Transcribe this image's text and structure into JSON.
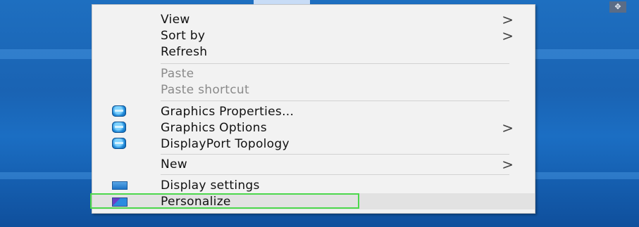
{
  "menu": {
    "items": [
      {
        "label": "View",
        "submenu": true
      },
      {
        "label": "Sort by",
        "submenu": true
      },
      {
        "label": "Refresh"
      },
      {
        "label": "Paste",
        "disabled": true
      },
      {
        "label": "Paste shortcut",
        "disabled": true
      },
      {
        "label": "Graphics Properties...",
        "icon": "intel-graphics-icon"
      },
      {
        "label": "Graphics Options",
        "icon": "intel-graphics-icon",
        "submenu": true
      },
      {
        "label": "DisplayPort Topology",
        "icon": "intel-graphics-icon"
      },
      {
        "label": "New",
        "submenu": true
      },
      {
        "label": "Display settings",
        "icon": "display-icon"
      },
      {
        "label": "Personalize",
        "icon": "personalize-icon",
        "highlighted": true
      }
    ],
    "submenu_glyph": ">"
  },
  "colors": {
    "desktop": "#1a63b3",
    "menu_bg": "#f2f2f2",
    "highlight_border": "#4cd84c"
  },
  "corner_icon": "move-icon"
}
